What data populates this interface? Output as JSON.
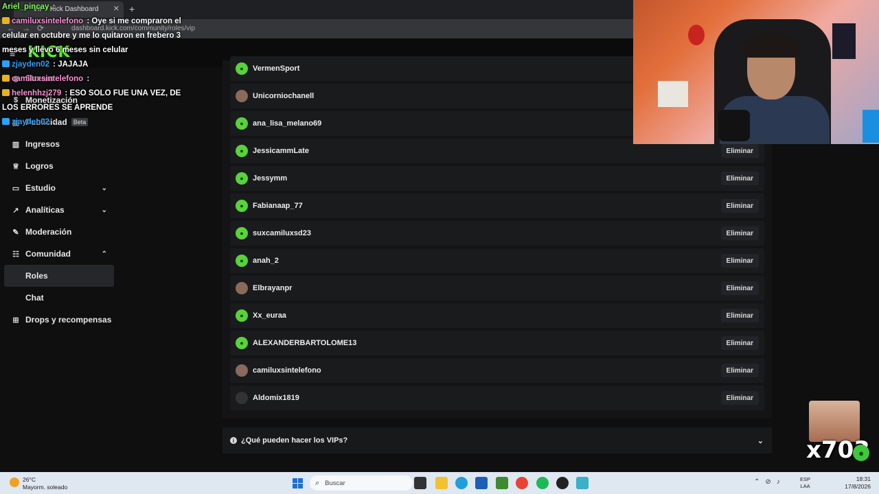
{
  "browser": {
    "tab_title": "VIP - Kick Dashboard",
    "tab_close": "✕",
    "new_tab": "+",
    "url": "dashboard.kick.com/community/roles/vip"
  },
  "app": {
    "logo": "KICK",
    "brand_color": "#53fc18"
  },
  "sidebar": {
    "items": [
      {
        "label": "Stream",
        "icon": "broadcast-icon"
      },
      {
        "label": "Monetización",
        "icon": "money-icon"
      },
      {
        "label": "Publicidad",
        "icon": "ad-icon",
        "badge": "Beta"
      },
      {
        "label": "Ingresos",
        "icon": "chart-icon"
      },
      {
        "label": "Logros",
        "icon": "trophy-icon"
      },
      {
        "label": "Estudio",
        "icon": "monitor-icon",
        "chevron": "⌄"
      },
      {
        "label": "Analíticas",
        "icon": "analytics-icon",
        "chevron": "⌄"
      },
      {
        "label": "Moderación",
        "icon": "wrench-icon"
      },
      {
        "label": "Comunidad",
        "icon": "community-icon",
        "chevron": "⌃"
      },
      {
        "label": "Roles",
        "active": true
      },
      {
        "label": "Chat"
      },
      {
        "label": "Drops y recompensas",
        "icon": "gift-icon"
      }
    ]
  },
  "vip_list": {
    "delete_label": "Eliminar",
    "users": [
      "VermenSport",
      "Unicorniochanell",
      "ana_lisa_melano69",
      "JessicammLate",
      "Jessymm",
      "Fabianaap_77",
      "suxcamiluxsd23",
      "anah_2",
      "Elbrayanpr",
      "Xx_euraa",
      "ALEXANDERBARTOLOME13",
      "camiluxsintelefono",
      "Aldomix1819"
    ]
  },
  "faq": {
    "label": "¿Qué pueden hacer los VIPs?",
    "chevron": "⌄"
  },
  "chat_overlay": {
    "messages": [
      {
        "user": "Ariel_pincay",
        "user_color": "#7cff4f",
        "text": ""
      },
      {
        "user": "camiluxsintelefono",
        "user_color": "#ff8fd5",
        "text": "Oye si me compraron el celular en octubre y me lo quitaron en frebero 3 meses y llevo 6 meses sin celular"
      },
      {
        "user": "zjayden02",
        "user_color": "#29a3ff",
        "text": "JAJAJA"
      },
      {
        "user": "camiluxsintelefono",
        "user_color": "#ff8fd5",
        "text": ""
      },
      {
        "user": "helenhhzj279",
        "user_color": "#ff8fd5",
        "text": "ESO SOLO FUE UNA VEZ, DE LOS ERRORES SE APRENDE"
      },
      {
        "user": "zjayden02",
        "user_color": "#29a3ff",
        "text": ""
      }
    ]
  },
  "emote_overlay": {
    "count": "x703"
  },
  "taskbar": {
    "temperature": "26°C",
    "weather": "Mayorm. soleado",
    "search_placeholder": "Buscar",
    "lang_line1": "ESP",
    "lang_line2": "LAA",
    "time": "18:31",
    "date": "17/8/2026"
  }
}
